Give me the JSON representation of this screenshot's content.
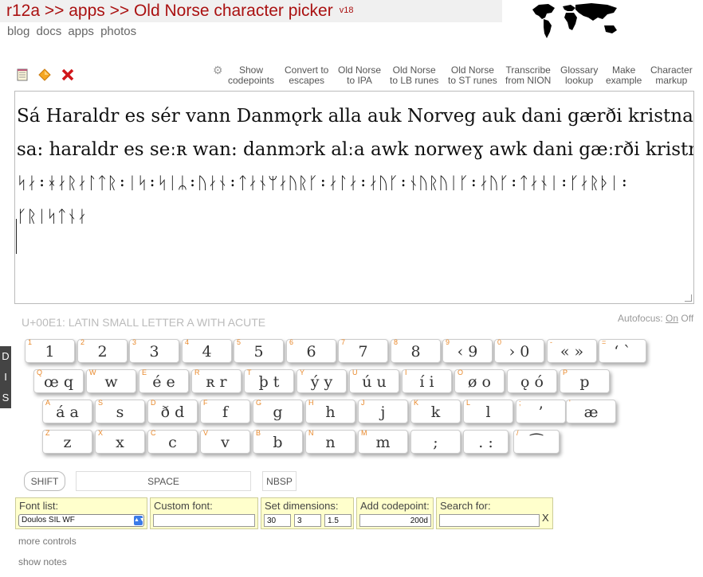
{
  "header": {
    "title": "r12a >> apps >> Old Norse character picker",
    "version": "v18",
    "nav": [
      "blog",
      "docs",
      "apps",
      "photos"
    ]
  },
  "toolbar": {
    "icons": [
      {
        "name": "notepad-icon"
      },
      {
        "name": "diamond-icon"
      },
      {
        "name": "close-icon"
      }
    ],
    "buttons": [
      {
        "l1": "Show",
        "l2": "codepoints"
      },
      {
        "l1": "Convert to",
        "l2": "escapes"
      },
      {
        "l1": "Old Norse",
        "l2": "to IPA"
      },
      {
        "l1": "Old Norse",
        "l2": "to LB runes"
      },
      {
        "l1": "Old Norse",
        "l2": "to ST runes"
      },
      {
        "l1": "Transcribe",
        "l2": "from NION"
      },
      {
        "l1": "Glossary",
        "l2": "lookup"
      },
      {
        "l1": "Make",
        "l2": "example"
      },
      {
        "l1": "Character",
        "l2": "markup"
      }
    ]
  },
  "output": {
    "lines": [
      "Sá Haraldr es sér vann Danmǫrk alla auk Norveg auk dani gærði kristna.",
      "sa: haraldr es seːʀ wan: danmɔrk alːa awk norweɣ awk dani gæːrði kristna.",
      "ᛋᛅ᛬ᚼᛅᚱᛅᛚᛏᚱ᛬ᛁᛋ᛬ᛋᛁᛦ᛬ᚢᛅᚾ᛬ᛏᛅᚾᛘᛅᚢᚱᚴ᛬ᛅᛚᛅ᛬ᛅᚢᚴ᛬ᚾᚢᚱᚢᛁᚴ᛬ᛅᚢᚴ᛬ᛏᛅᚾᛁ᛬ᚴᛅᚱᚦᛁ᛬",
      "ᚴᚱᛁᛋᛏᚾᛅ"
    ]
  },
  "charinfo": "U+00E1: LATIN SMALL LETTER A WITH ACUTE",
  "autofocus": {
    "label": "Autofocus:",
    "on": "On",
    "off": "Off"
  },
  "sidetab": [
    "D",
    "I",
    "S"
  ],
  "keyboard": {
    "row1": [
      {
        "lb": "1",
        "t": "1"
      },
      {
        "lb": "2",
        "t": "2"
      },
      {
        "lb": "3",
        "t": "3"
      },
      {
        "lb": "4",
        "t": "4"
      },
      {
        "lb": "5",
        "t": "5"
      },
      {
        "lb": "6",
        "t": "6"
      },
      {
        "lb": "7",
        "t": "7"
      },
      {
        "lb": "8",
        "t": "8"
      },
      {
        "lb": "9",
        "t": "‹ 9"
      },
      {
        "lb": "0",
        "t": "› 0"
      },
      {
        "lb": "-",
        "t": "« »"
      },
      {
        "lb": "=",
        "t": "‘ `"
      }
    ],
    "row2": [
      {
        "lb": "Q",
        "t": "œ q"
      },
      {
        "lb": "W",
        "t": "w"
      },
      {
        "lb": "E",
        "t": "é e"
      },
      {
        "lb": "R",
        "t": "ʀ r"
      },
      {
        "lb": "T",
        "t": "þ t"
      },
      {
        "lb": "Y",
        "t": "ý y"
      },
      {
        "lb": "U",
        "t": "ú u"
      },
      {
        "lb": "I",
        "t": "í i"
      },
      {
        "lb": "O",
        "t": "ø o"
      },
      {
        "lb": "",
        "t": "ǫ ó"
      },
      {
        "lb": "P",
        "t": "p"
      }
    ],
    "row3": [
      {
        "lb": "A",
        "t": "á a"
      },
      {
        "lb": "S",
        "t": "s"
      },
      {
        "lb": "D",
        "t": "ð d"
      },
      {
        "lb": "F",
        "t": "f"
      },
      {
        "lb": "G",
        "t": "g"
      },
      {
        "lb": "H",
        "t": "h"
      },
      {
        "lb": "J",
        "t": "j"
      },
      {
        "lb": "K",
        "t": "k"
      },
      {
        "lb": "L",
        "t": "l"
      },
      {
        "lb": ";",
        "t": "’"
      },
      {
        "lb": "'",
        "t": "æ"
      }
    ],
    "row4": [
      {
        "lb": "Z",
        "t": "z"
      },
      {
        "lb": "X",
        "t": "x"
      },
      {
        "lb": "C",
        "t": "c"
      },
      {
        "lb": "V",
        "t": "v"
      },
      {
        "lb": "B",
        "t": "b"
      },
      {
        "lb": "N",
        "t": "n"
      },
      {
        "lb": "M",
        "t": "m"
      },
      {
        "lb": "",
        "t": ";"
      },
      {
        "lb": "",
        "t": ". :"
      },
      {
        "lb": "/",
        "t": "⁀"
      }
    ]
  },
  "controls": {
    "shift": "SHIFT",
    "space": "SPACE",
    "nbsp": "NBSP",
    "font_list": {
      "label": "Font list:",
      "value": "Doulos SIL WF"
    },
    "custom_font": {
      "label": "Custom font:",
      "value": ""
    },
    "dimensions": {
      "label": "Set dimensions:",
      "v1": "30",
      "v2": "3",
      "v3": "1.5"
    },
    "add_codepoint": {
      "label": "Add codepoint:",
      "value": "200d"
    },
    "search": {
      "label": "Search for:",
      "value": "",
      "clear": "X"
    },
    "more": "more controls",
    "notes": "show notes"
  }
}
